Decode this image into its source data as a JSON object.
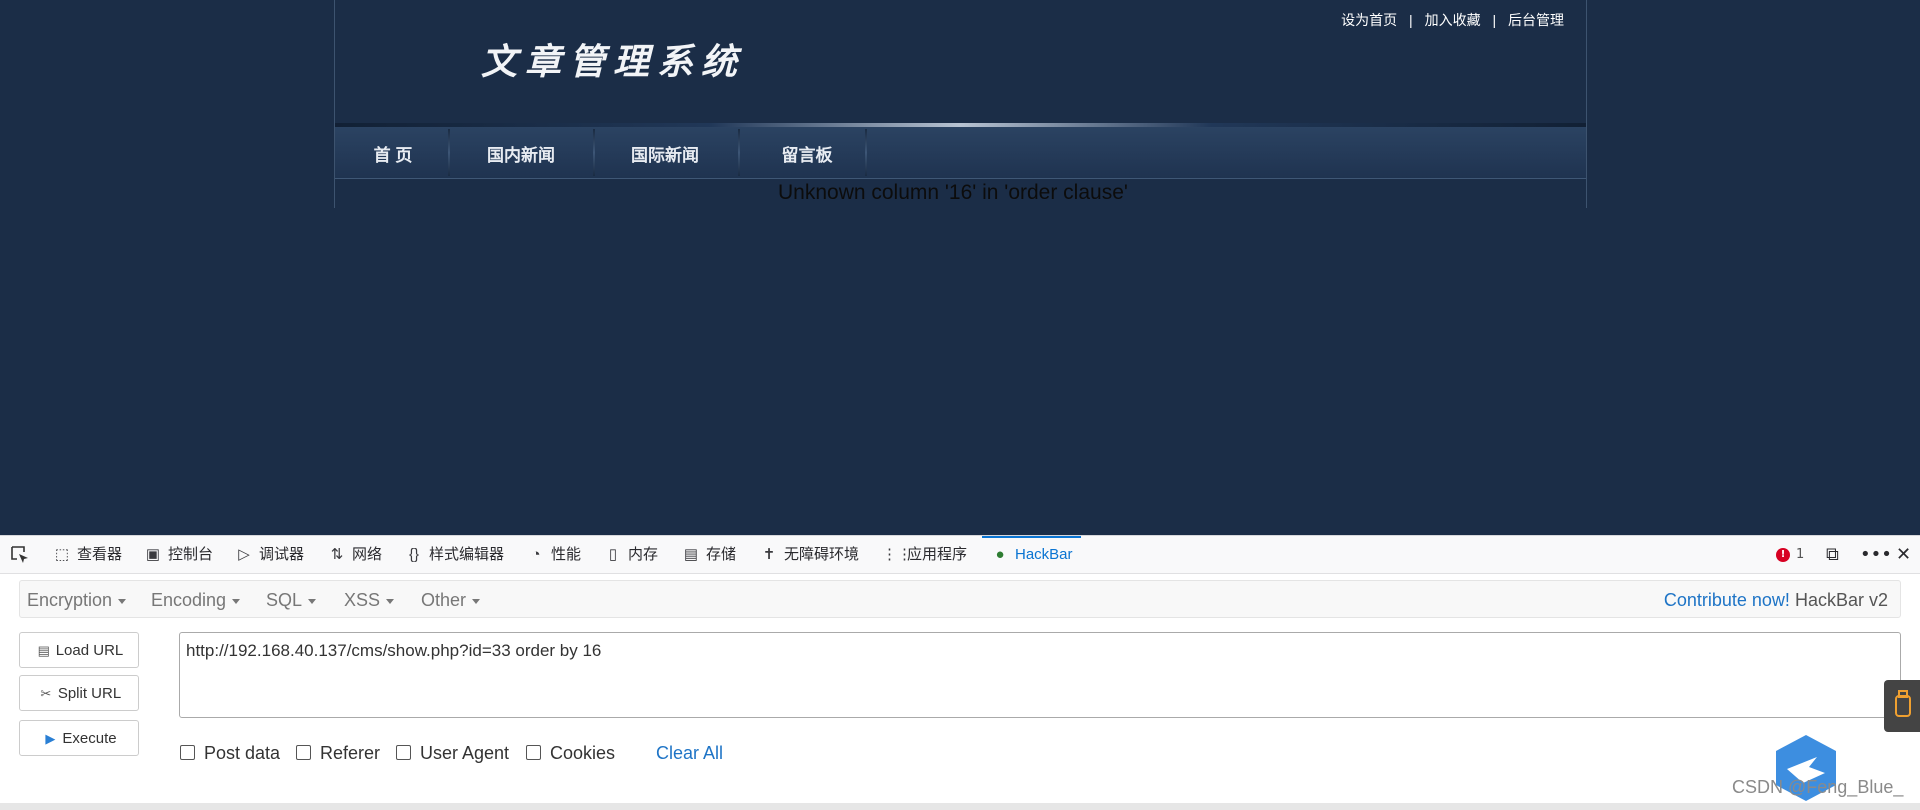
{
  "site": {
    "title": "文章管理系统",
    "toplinks": [
      "设为首页",
      "加入收藏",
      "后台管理"
    ],
    "separator": "|",
    "nav": [
      "首 页",
      "国内新闻",
      "国际新闻",
      "留言板"
    ],
    "error_message": "Unknown column '16' in 'order clause'"
  },
  "devtools": {
    "tabs": [
      {
        "label": "查看器",
        "icon": "inspector-icon"
      },
      {
        "label": "控制台",
        "icon": "console-icon"
      },
      {
        "label": "调试器",
        "icon": "debugger-icon"
      },
      {
        "label": "网络",
        "icon": "network-icon"
      },
      {
        "label": "样式编辑器",
        "icon": "style-editor-icon"
      },
      {
        "label": "性能",
        "icon": "performance-icon"
      },
      {
        "label": "内存",
        "icon": "memory-icon"
      },
      {
        "label": "存储",
        "icon": "storage-icon"
      },
      {
        "label": "无障碍环境",
        "icon": "accessibility-icon"
      },
      {
        "label": "应用程序",
        "icon": "application-icon"
      },
      {
        "label": "HackBar",
        "icon": "hackbar-icon",
        "active": true
      }
    ],
    "error_count": "1",
    "accent_color": "#0a74d2"
  },
  "hackbar": {
    "menu": [
      "Encryption",
      "Encoding",
      "SQL",
      "XSS",
      "Other"
    ],
    "contribute_link": "Contribute now!",
    "version": "HackBar v2",
    "buttons": {
      "load": "Load URL",
      "split": "Split URL",
      "execute": "Execute"
    },
    "url": "http://192.168.40.137/cms/show.php?id=33 order by 16",
    "options": [
      "Post data",
      "Referer",
      "User Agent",
      "Cookies"
    ],
    "clear_all": "Clear All"
  },
  "watermark": "CSDN @Feng_Blue_"
}
